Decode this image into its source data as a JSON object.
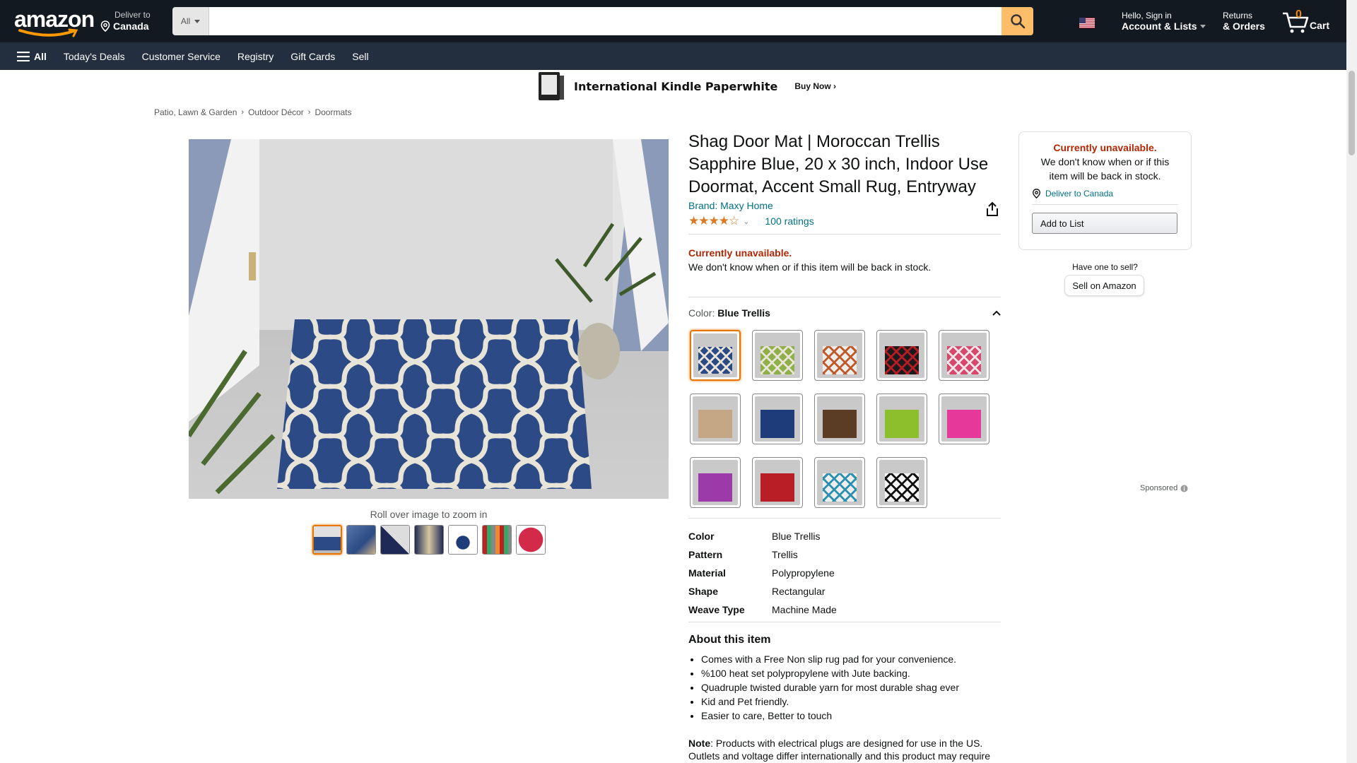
{
  "nav": {
    "logo": "amazon",
    "deliver_line1": "Deliver to",
    "deliver_line2": "Canada",
    "search_category": "All",
    "search_placeholder": "",
    "account_line1": "Hello, Sign in",
    "account_line2": "Account & Lists",
    "returns_line1": "Returns",
    "returns_line2": "& Orders",
    "cart_count": "0",
    "cart_label": "Cart"
  },
  "subnav": {
    "all": "All",
    "items": [
      "Today's Deals",
      "Customer Service",
      "Registry",
      "Gift Cards",
      "Sell"
    ]
  },
  "banner": {
    "title": "International Kindle Paperwhite",
    "cta": "Buy Now ›"
  },
  "breadcrumb": [
    "Patio, Lawn & Garden",
    "Outdoor Décor",
    "Doormats"
  ],
  "gallery": {
    "zoom_hint": "Roll over image to zoom in",
    "thumb_count": 7
  },
  "product": {
    "title": "Shag Door Mat | Moroccan Trellis Sapphire Blue, 20 x 30 inch, Indoor Use Doormat, Accent Small Rug, Entryway",
    "brand": "Brand: Maxy Home",
    "rating_stars": "★★★★☆",
    "rating_value": 3.8,
    "ratings_count": "100 ratings",
    "unavailable": "Currently unavailable.",
    "unavailable_sub": "We don't know when or if this item will be back in stock.",
    "color_label": "Color: ",
    "color_value": "Blue Trellis",
    "swatches": [
      {
        "name": "blue-trellis",
        "base": "#2c4a85",
        "accent": "#e8e4d8"
      },
      {
        "name": "green-trellis",
        "base": "#8fb048",
        "accent": "#e8e4d8"
      },
      {
        "name": "orange-wave",
        "base": "#efeeeb",
        "accent": "#c1582a"
      },
      {
        "name": "red-squares",
        "base": "#1b1b1b",
        "accent": "#b71c24"
      },
      {
        "name": "pink-trellis",
        "base": "#d8486d",
        "accent": "#f3e6ea"
      },
      {
        "name": "beige",
        "base": "#c6a785",
        "accent": "#c6a785"
      },
      {
        "name": "navy",
        "base": "#1e3b7a",
        "accent": "#1e3b7a"
      },
      {
        "name": "brown",
        "base": "#5a3d24",
        "accent": "#5a3d24"
      },
      {
        "name": "lime",
        "base": "#8dbf2c",
        "accent": "#8dbf2c"
      },
      {
        "name": "hot-pink",
        "base": "#e6389b",
        "accent": "#e6389b"
      },
      {
        "name": "purple",
        "base": "#9b3aa8",
        "accent": "#9b3aa8"
      },
      {
        "name": "red",
        "base": "#b71f24",
        "accent": "#b71f24"
      },
      {
        "name": "teal-wave",
        "base": "#eeeeee",
        "accent": "#2b8fb0"
      },
      {
        "name": "zebra",
        "base": "#f5f5f5",
        "accent": "#111111"
      }
    ],
    "specs": [
      {
        "k": "Color",
        "v": "Blue Trellis"
      },
      {
        "k": "Pattern",
        "v": "Trellis"
      },
      {
        "k": "Material",
        "v": "Polypropylene"
      },
      {
        "k": "Shape",
        "v": "Rectangular"
      },
      {
        "k": "Weave Type",
        "v": "Machine Made"
      }
    ],
    "about_title": "About this item",
    "bullets": [
      "Comes with a Free Non slip rug pad for your convenience.",
      "%100 heat set polypropylene with Jute backing.",
      "Quadruple twisted durable yarn for most durable shag ever",
      "Kid and Pet friendly.",
      "Easier to care, Better to touch"
    ],
    "note_label": "Note",
    "note_text": ": Products with electrical plugs are designed for use in the US. Outlets and voltage differ internationally and this product may require"
  },
  "buybox": {
    "unavailable": "Currently unavailable.",
    "sub": "We don't know when or if this item will be back in stock.",
    "deliver": "Deliver to Canada",
    "add_to_list": "Add to List",
    "have_one": "Have one to sell?",
    "sell": "Sell on Amazon",
    "sponsored": "Sponsored"
  },
  "colors": {
    "nav_bg": "#131921",
    "subnav_bg": "#232f3e",
    "search_btn": "#febd69",
    "link": "#007185",
    "unavailable": "#b12704",
    "star": "#de7921",
    "selected_border": "#e77600"
  }
}
